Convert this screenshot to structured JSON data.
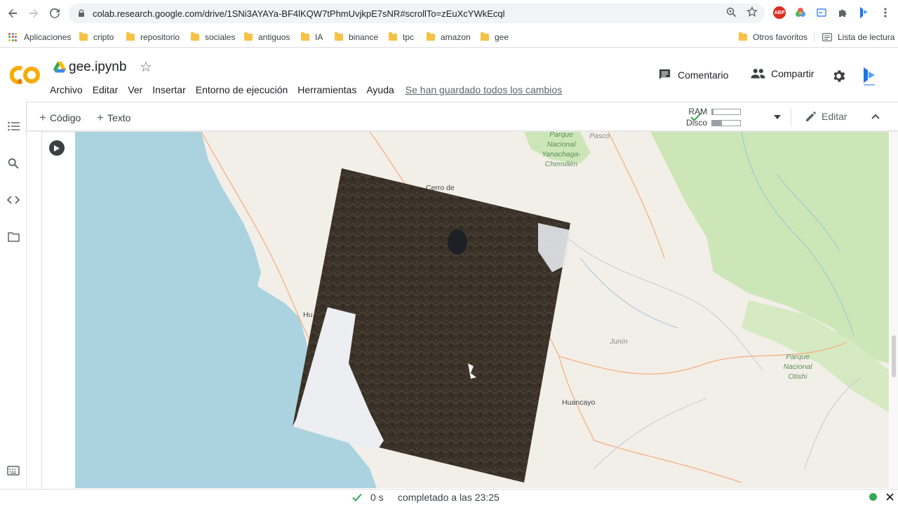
{
  "browser": {
    "url": "colab.research.google.com/drive/1SNi3AYAYa-BF4lKQW7tPhmUvjkpE7sNR#scrollTo=zEuXcYWkEcql",
    "extension_badge": "ABP",
    "bookmarks": [
      {
        "label": "Aplicaciones"
      },
      {
        "label": "cripto"
      },
      {
        "label": "repositorio"
      },
      {
        "label": "sociales"
      },
      {
        "label": "antiguos"
      },
      {
        "label": "IA"
      },
      {
        "label": "binance"
      },
      {
        "label": "tpc"
      },
      {
        "label": "amazon"
      },
      {
        "label": "gee"
      }
    ],
    "other_bookmarks": "Otros favoritos",
    "reading_list": "Lista de lectura"
  },
  "colab": {
    "notebook_title": "gee.ipynb",
    "menu": [
      "Archivo",
      "Editar",
      "Ver",
      "Insertar",
      "Entorno de ejecución",
      "Herramientas",
      "Ayuda"
    ],
    "saved_status": "Se han guardado todos los cambios",
    "comment_label": "Comentario",
    "share_label": "Compartir",
    "add_code_label": "Código",
    "add_text_label": "Texto",
    "ram_label": "RAM",
    "disk_label": "Disco",
    "ram_usage": 0.05,
    "disk_usage": 0.35,
    "edit_label": "Editar"
  },
  "map": {
    "labels": {
      "park1": [
        "Parque",
        "Nacional",
        "Yanachaga-",
        "Chemillén"
      ],
      "pasco": "Pasco",
      "cerro": "Cerro de",
      "junin": "Junín",
      "huancayo": "Huancayo",
      "park2": [
        "Parque",
        "Nacional",
        "Otishi"
      ],
      "hu": "Hu"
    }
  },
  "status": {
    "elapsed": "0 s",
    "completed_text": "completado a las 23:25"
  },
  "colors": {
    "accent_orange": "#f9ab00",
    "check_green": "#34a853",
    "water": "#aad3df",
    "forest": "#cde6b8"
  }
}
